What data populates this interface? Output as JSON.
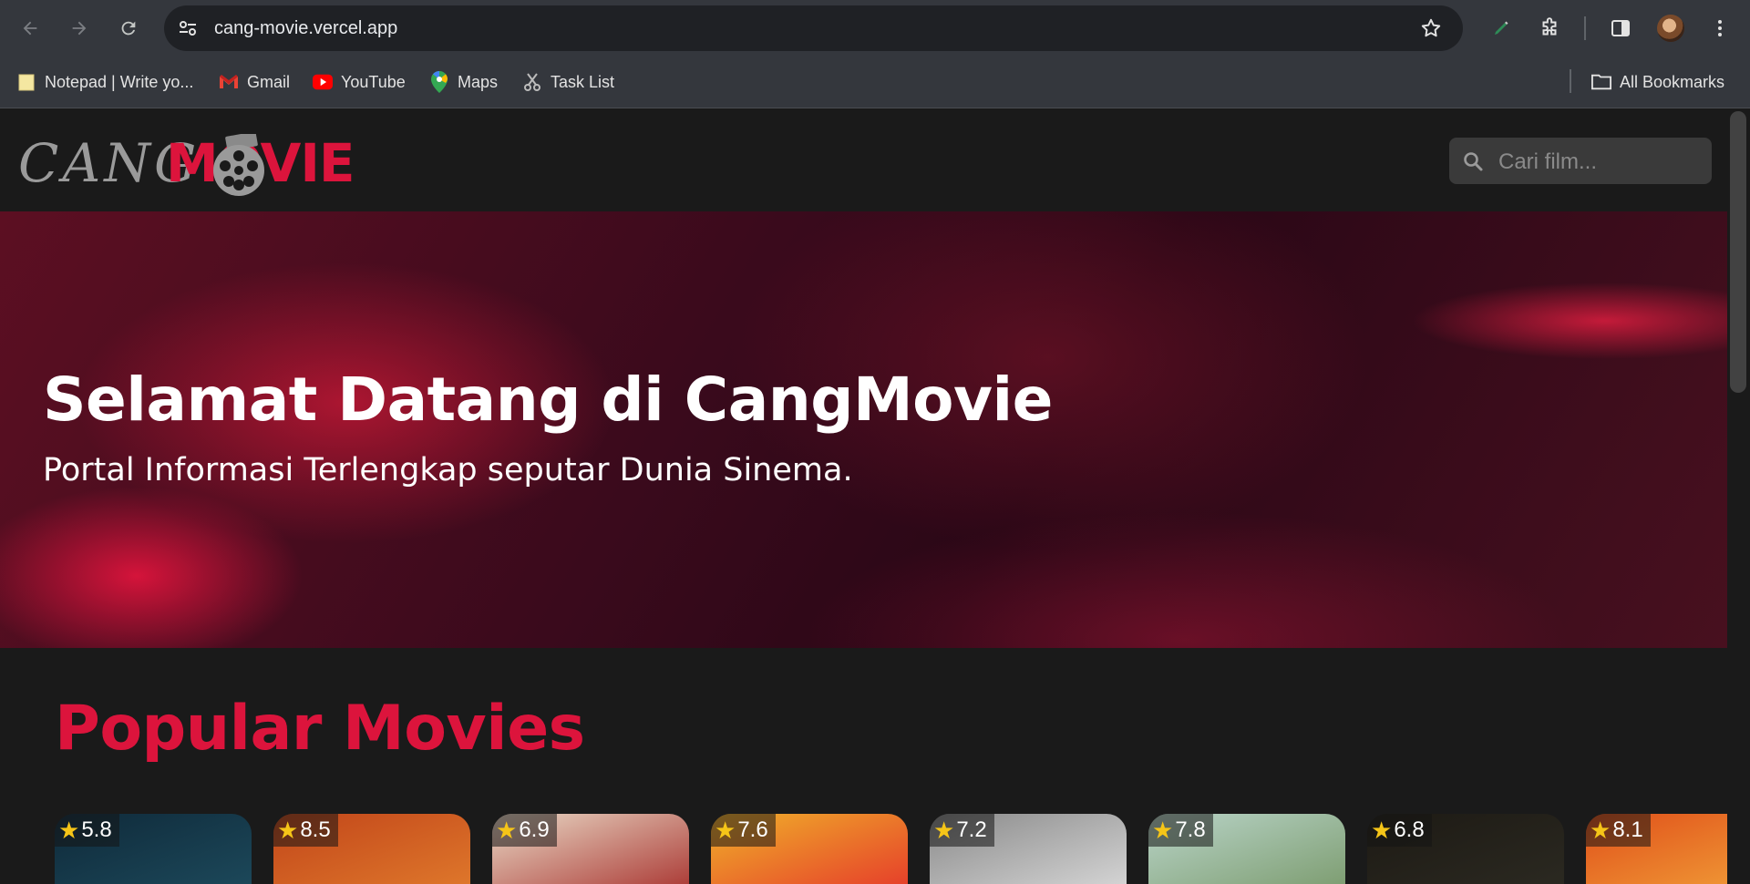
{
  "browser": {
    "url": "cang-movie.vercel.app",
    "bookmarks": [
      {
        "label": "Notepad | Write yo...",
        "icon": "notepad-icon"
      },
      {
        "label": "Gmail",
        "icon": "gmail-icon"
      },
      {
        "label": "YouTube",
        "icon": "youtube-icon"
      },
      {
        "label": "Maps",
        "icon": "maps-icon"
      },
      {
        "label": "Task List",
        "icon": "task-list-icon"
      }
    ],
    "all_bookmarks": "All Bookmarks"
  },
  "site": {
    "logo_cang": "CANG",
    "logo_movie": "MOVIE",
    "search_placeholder": "Cari film..."
  },
  "hero": {
    "title": "Selamat Datang di CangMovie",
    "subtitle": "Portal Informasi Terlengkap seputar Dunia Sinema."
  },
  "popular": {
    "title": "Popular Movies",
    "movies": [
      {
        "rating": "5.8",
        "colors": [
          "#0f2a3a",
          "#1d4a5c"
        ]
      },
      {
        "rating": "8.5",
        "colors": [
          "#c2461a",
          "#e07a2c"
        ]
      },
      {
        "rating": "6.9",
        "colors": [
          "#e9d9c6",
          "#a8322e"
        ]
      },
      {
        "rating": "7.6",
        "colors": [
          "#f0b02a",
          "#e5382a"
        ]
      },
      {
        "rating": "7.2",
        "colors": [
          "#8a8a8a",
          "#d9d9d9"
        ]
      },
      {
        "rating": "7.8",
        "colors": [
          "#b9d4c8",
          "#7a9a6c"
        ]
      },
      {
        "rating": "6.8",
        "colors": [
          "#1d1a14",
          "#2c2a22"
        ]
      },
      {
        "rating": "8.1",
        "colors": [
          "#e0501a",
          "#f2a43a"
        ]
      }
    ]
  },
  "colors": {
    "accent": "#dc143c",
    "page_bg": "#1a1a1a"
  }
}
